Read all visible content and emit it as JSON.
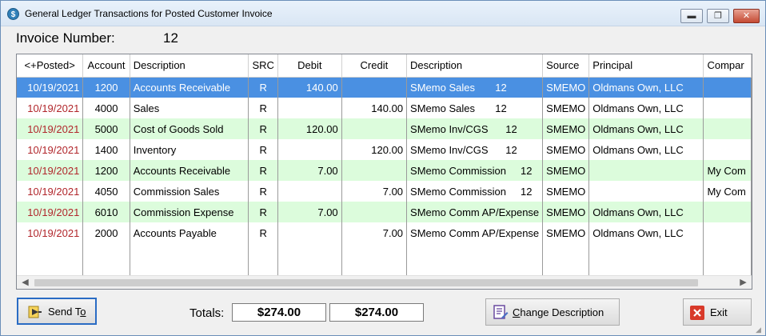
{
  "window": {
    "title": "General Ledger Transactions for Posted Customer Invoice",
    "min_glyph": "▬",
    "max_glyph": "❐",
    "close_glyph": "✕"
  },
  "invoice": {
    "label": "Invoice Number:",
    "number": "12"
  },
  "grid": {
    "columns": [
      "<+Posted>",
      "Account",
      "Description",
      "SRC",
      "Debit",
      "Credit",
      "Description",
      "Source",
      "Principal",
      "Compar"
    ],
    "rows": [
      {
        "posted": "10/19/2021",
        "account": "1200",
        "description": "Accounts Receivable",
        "src": "R",
        "debit": "140.00",
        "credit": "",
        "memo": "SMemo Sales       12",
        "source": "SMEMO",
        "principal": "Oldmans Own, LLC",
        "company": ""
      },
      {
        "posted": "10/19/2021",
        "account": "4000",
        "description": "Sales",
        "src": "R",
        "debit": "",
        "credit": "140.00",
        "memo": "SMemo Sales       12",
        "source": "SMEMO",
        "principal": "Oldmans Own, LLC",
        "company": ""
      },
      {
        "posted": "10/19/2021",
        "account": "5000",
        "description": "Cost of Goods Sold",
        "src": "R",
        "debit": "120.00",
        "credit": "",
        "memo": "SMemo Inv/CGS      12",
        "source": "SMEMO",
        "principal": "Oldmans Own, LLC",
        "company": ""
      },
      {
        "posted": "10/19/2021",
        "account": "1400",
        "description": "Inventory",
        "src": "R",
        "debit": "",
        "credit": "120.00",
        "memo": "SMemo Inv/CGS      12",
        "source": "SMEMO",
        "principal": "Oldmans Own, LLC",
        "company": ""
      },
      {
        "posted": "10/19/2021",
        "account": "1200",
        "description": "Accounts Receivable",
        "src": "R",
        "debit": "7.00",
        "credit": "",
        "memo": "SMemo Commission     12",
        "source": "SMEMO",
        "principal": "",
        "company": "My Com"
      },
      {
        "posted": "10/19/2021",
        "account": "4050",
        "description": "Commission Sales",
        "src": "R",
        "debit": "",
        "credit": "7.00",
        "memo": "SMemo Commission     12",
        "source": "SMEMO",
        "principal": "",
        "company": "My Com"
      },
      {
        "posted": "10/19/2021",
        "account": "6010",
        "description": "Commission Expense",
        "src": "R",
        "debit": "7.00",
        "credit": "",
        "memo": "SMemo Comm AP/Expense",
        "source": "SMEMO",
        "principal": "Oldmans Own, LLC",
        "company": ""
      },
      {
        "posted": "10/19/2021",
        "account": "2000",
        "description": "Accounts Payable",
        "src": "R",
        "debit": "",
        "credit": "7.00",
        "memo": "SMemo Comm AP/Expense",
        "source": "SMEMO",
        "principal": "Oldmans Own, LLC",
        "company": ""
      }
    ],
    "selected_row": 0
  },
  "footer": {
    "send_to_label": "Send To",
    "totals_label": "Totals:",
    "total_debit": "$274.00",
    "total_credit": "$274.00",
    "change_description_label": "Change Description",
    "exit_label": "Exit"
  },
  "colors": {
    "selected_row": "#4a90e2",
    "alt_row": "#dcfcdc",
    "posted_date": "#b1262b"
  }
}
